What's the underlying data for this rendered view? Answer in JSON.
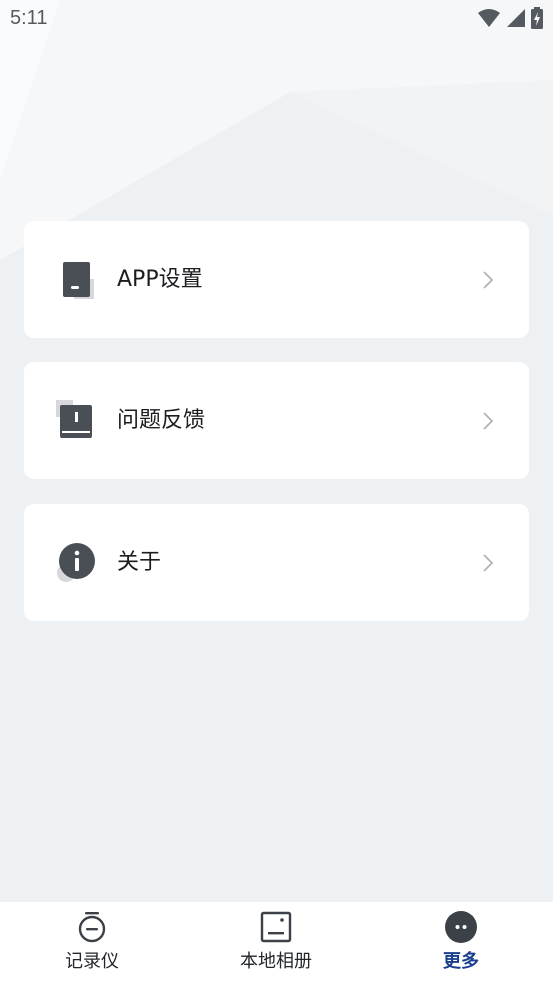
{
  "status_bar": {
    "time": "5:11",
    "icons": [
      "wifi-icon",
      "signal-icon",
      "battery-charging-icon"
    ]
  },
  "menu": {
    "items": [
      {
        "label": "APP设置",
        "icon": "phone-settings-icon"
      },
      {
        "label": "问题反馈",
        "icon": "feedback-book-icon"
      },
      {
        "label": "关于",
        "icon": "info-icon"
      }
    ]
  },
  "tab_bar": {
    "items": [
      {
        "label": "记录仪",
        "icon": "recorder-icon",
        "active": false
      },
      {
        "label": "本地相册",
        "icon": "album-icon",
        "active": false
      },
      {
        "label": "更多",
        "icon": "more-icon",
        "active": true
      }
    ]
  },
  "colors": {
    "background": "#eef1f4",
    "card": "#ffffff",
    "icon_dark": "#4a4e55",
    "active_tab": "#1a3f8f",
    "chevron": "#b0b4ba"
  }
}
